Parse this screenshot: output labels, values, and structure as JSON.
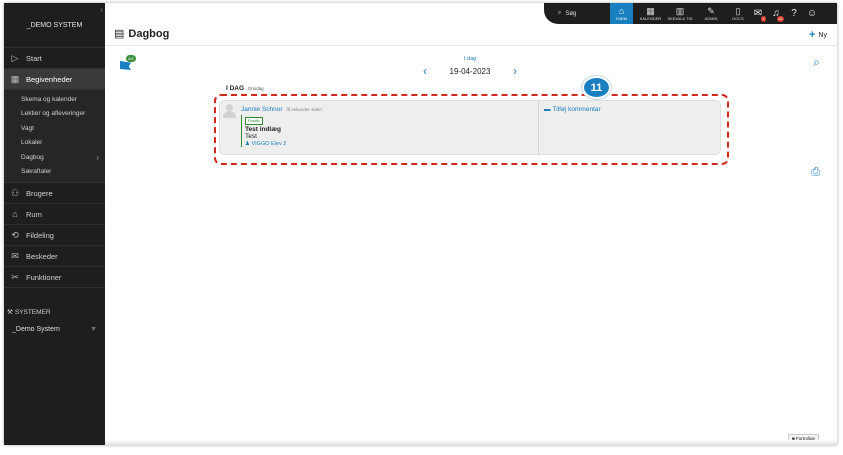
{
  "sidebar": {
    "collapse_glyph": "‹",
    "brand": "_DEMO SYSTEM",
    "items": [
      {
        "label": "Start",
        "icon": "play-outline-icon",
        "glyph": "▷"
      },
      {
        "label": "Begivenheder",
        "icon": "calendar-icon",
        "glyph": "▦"
      },
      {
        "label": "Brugere",
        "icon": "users-icon",
        "glyph": "⚇"
      },
      {
        "label": "Rum",
        "icon": "room-icon",
        "glyph": "⌂"
      },
      {
        "label": "Fildeling",
        "icon": "share-icon",
        "glyph": "⟲"
      },
      {
        "label": "Beskeder",
        "icon": "chat-icon",
        "glyph": "✉"
      },
      {
        "label": "Funktioner",
        "icon": "tools-icon",
        "glyph": "✂"
      }
    ],
    "sub_items": [
      "Skema og kalender",
      "Lektier og afleveringer",
      "Vagt",
      "Lokaler",
      "Dagbog",
      "Særaftaler"
    ],
    "sub_chevron": "›",
    "systems_label": "SYSTEMER",
    "systems_glyph": "⚒",
    "system_name": "_Demo System",
    "system_caret": "▼"
  },
  "topbar": {
    "search_label": "Søg",
    "search_glyph": "⌕",
    "home_label": "HJEM",
    "home_glyph": "⌂",
    "calendar_label": "KALENDER",
    "calendar_glyph": "▦",
    "schedule_label": "SKEMA & TID",
    "schedule_glyph": "▥",
    "admin_label": "ADMIN",
    "admin_glyph": "✎",
    "docs_label": "DOCS",
    "docs_glyph": "▯",
    "messages_glyph": "✉",
    "messages_badge": "3",
    "notifications_glyph": "♫",
    "notifications_badge": "18",
    "help_glyph": "?",
    "profile_glyph": "☺"
  },
  "page": {
    "title": "Dagbog",
    "title_glyph": "▤",
    "new_label": "Ny",
    "new_glyph": "+",
    "flag_count": "4/4",
    "search_glyph": "⌕",
    "print_glyph": "⎙",
    "today_link": "I dag",
    "prev_glyph": "‹",
    "next_glyph": "›",
    "date": "19-04-2023",
    "day_heading": "I DAG",
    "weekday": "Onsdag",
    "step_number": "11",
    "hint": "Fortrolige",
    "hint_glyph": "■"
  },
  "entry": {
    "author": "Jannie Schnor",
    "time_ago": "få sekunder siden",
    "tag": "Positiv",
    "title": "Test indlæg",
    "text": "Test",
    "user": "VIGGO Elev 2",
    "user_glyph": "♟",
    "comment_label": "Tilføj kommentar",
    "comment_glyph": "▬"
  },
  "colors": {
    "accent": "#1a7fbf",
    "sidebar_bg": "#1e1e1e",
    "highlight": "#d12a1d",
    "tag_green": "#2e8b2e"
  }
}
